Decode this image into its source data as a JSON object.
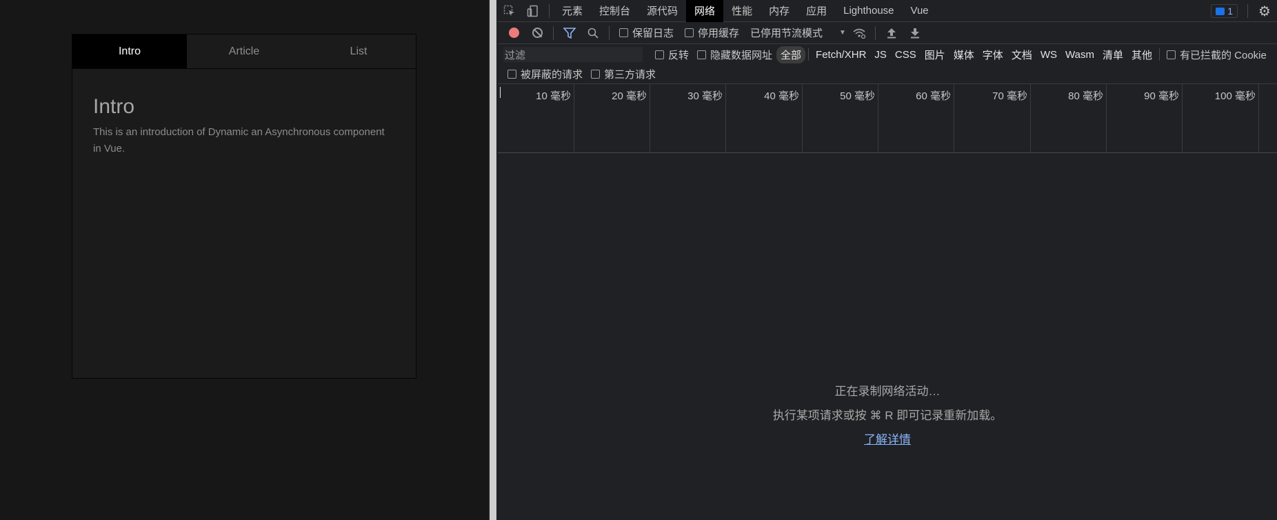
{
  "app": {
    "tabs": [
      "Intro",
      "Article",
      "List"
    ],
    "active_tab": "Intro",
    "content": {
      "title": "Intro",
      "text": "This is an introduction of Dynamic an Asynchronous component in Vue."
    }
  },
  "devtools": {
    "tabs": [
      "元素",
      "控制台",
      "源代码",
      "网络",
      "性能",
      "内存",
      "应用",
      "Lighthouse",
      "Vue"
    ],
    "active_tab": "网络",
    "issues_count": "1",
    "toolbar": {
      "preserve_log": "保留日志",
      "disable_cache": "停用缓存",
      "throttling": "已停用节流模式"
    },
    "filter": {
      "placeholder": "过滤",
      "invert": "反转",
      "hide_data_urls": "隐藏数据网址",
      "types": [
        "全部",
        "Fetch/XHR",
        "JS",
        "CSS",
        "图片",
        "媒体",
        "字体",
        "文档",
        "WS",
        "Wasm",
        "清单",
        "其他"
      ],
      "active_type": "全部",
      "blocked_cookies": "有已拦截的 Cookie",
      "blocked_requests": "被屏蔽的请求",
      "third_party": "第三方请求"
    },
    "timeline_ticks": [
      "10 毫秒",
      "20 毫秒",
      "30 毫秒",
      "40 毫秒",
      "50 毫秒",
      "60 毫秒",
      "70 毫秒",
      "80 毫秒",
      "90 毫秒",
      "100 毫秒"
    ],
    "empty_state": {
      "recording": "正在录制网络活动…",
      "hint": "执行某项请求或按 ⌘ R 即可记录重新加载。",
      "learn_more": "了解详情"
    },
    "colors": {
      "record": "#ee7b7b",
      "link": "#8ab4f8",
      "accent": "#1a73e8"
    }
  }
}
